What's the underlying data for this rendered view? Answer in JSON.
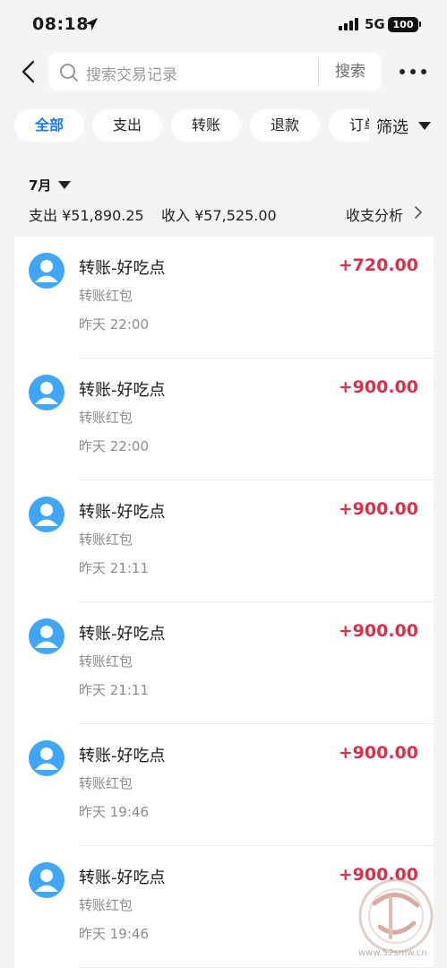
{
  "status_bar": {
    "time": "08:18",
    "network": "5G",
    "battery": "100"
  },
  "header": {
    "search_placeholder": "搜索交易记录",
    "search_button": "搜索"
  },
  "filters": {
    "chips": [
      {
        "label": "全部",
        "active": true
      },
      {
        "label": "支出",
        "active": false
      },
      {
        "label": "转账",
        "active": false
      },
      {
        "label": "退款",
        "active": false
      },
      {
        "label": "订单",
        "active": false
      }
    ],
    "filter_label": "筛选"
  },
  "summary": {
    "month": "7月",
    "expense": "支出 ¥51,890.25",
    "income": "收入 ¥57,525.00",
    "analysis_link": "收支分析"
  },
  "transactions": [
    {
      "title": "转账-好吃点",
      "subtitle": "转账红包",
      "time": "昨天 22:00",
      "amount": "+720.00"
    },
    {
      "title": "转账-好吃点",
      "subtitle": "转账红包",
      "time": "昨天 22:00",
      "amount": "+900.00"
    },
    {
      "title": "转账-好吃点",
      "subtitle": "转账红包",
      "time": "昨天 21:11",
      "amount": "+900.00"
    },
    {
      "title": "转账-好吃点",
      "subtitle": "转账红包",
      "time": "昨天 21:11",
      "amount": "+900.00"
    },
    {
      "title": "转账-好吃点",
      "subtitle": "转账红包",
      "time": "昨天 19:46",
      "amount": "+900.00"
    },
    {
      "title": "转账-好吃点",
      "subtitle": "转账红包",
      "time": "昨天 19:46",
      "amount": "+900.00"
    }
  ],
  "watermark": {
    "text": "www.52smw.cn"
  },
  "colors": {
    "accent": "#1677ff",
    "income": "#d9304b",
    "avatar": "#41a6f5",
    "background": "#f4f4f5"
  },
  "icons": [
    "location-arrow-icon",
    "signal-icon",
    "battery-icon",
    "back-icon",
    "search-icon",
    "more-icon",
    "caret-down-icon",
    "chevron-right-icon",
    "avatar-icon"
  ]
}
